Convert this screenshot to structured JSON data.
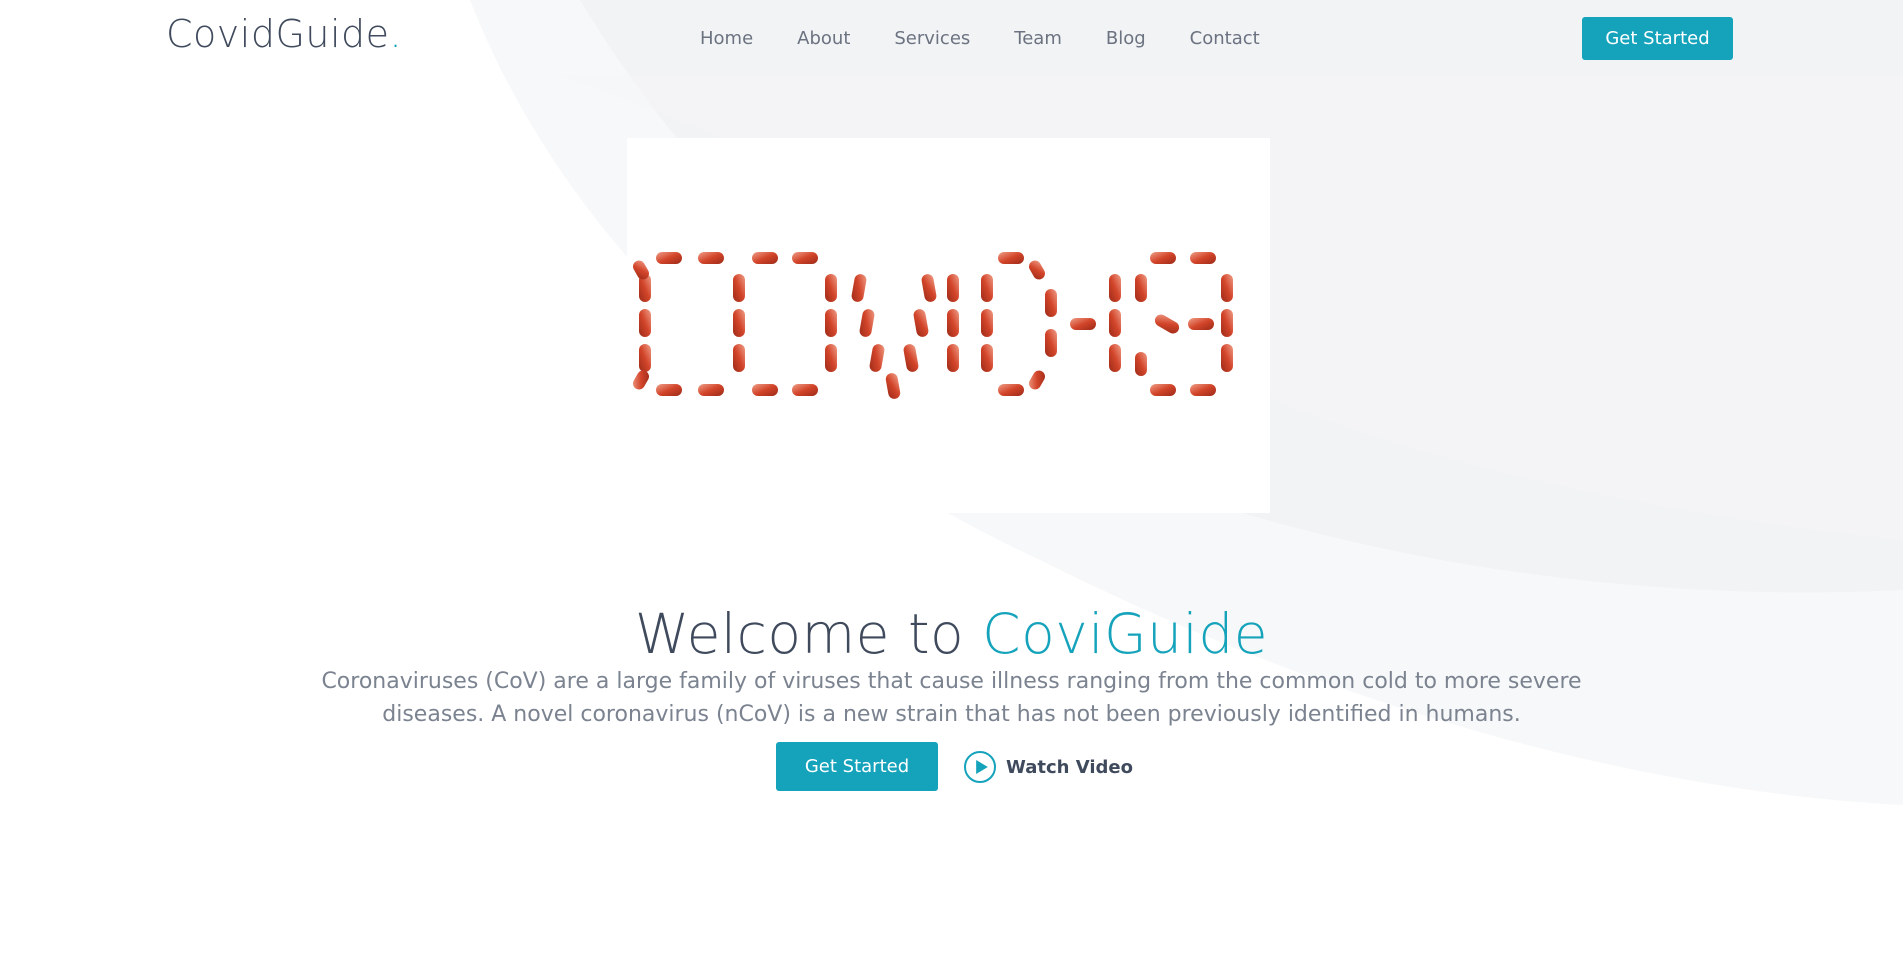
{
  "brand": {
    "name": "CovidGuide",
    "dot": "."
  },
  "nav": {
    "items": [
      {
        "label": "Home"
      },
      {
        "label": "About"
      },
      {
        "label": "Services"
      },
      {
        "label": "Team"
      },
      {
        "label": "Blog"
      },
      {
        "label": "Contact"
      }
    ],
    "cta_label": "Get Started"
  },
  "hero": {
    "image_text": "COVID-19",
    "title_prefix": "Welcome to",
    "title_accent": "CoviGuide",
    "description": "Coronaviruses (CoV) are a large family of viruses that cause illness ranging from the common cold to more severe diseases. A novel coronavirus (nCoV) is a new strain that has not been previously identified in humans.",
    "primary_cta": "Get Started",
    "video_cta": "Watch Video"
  },
  "colors": {
    "accent": "#15a3bc",
    "heading": "#3f4a5c",
    "text": "#7b8390",
    "pill": "#d2452a"
  },
  "icons": {
    "video": "play-icon"
  }
}
